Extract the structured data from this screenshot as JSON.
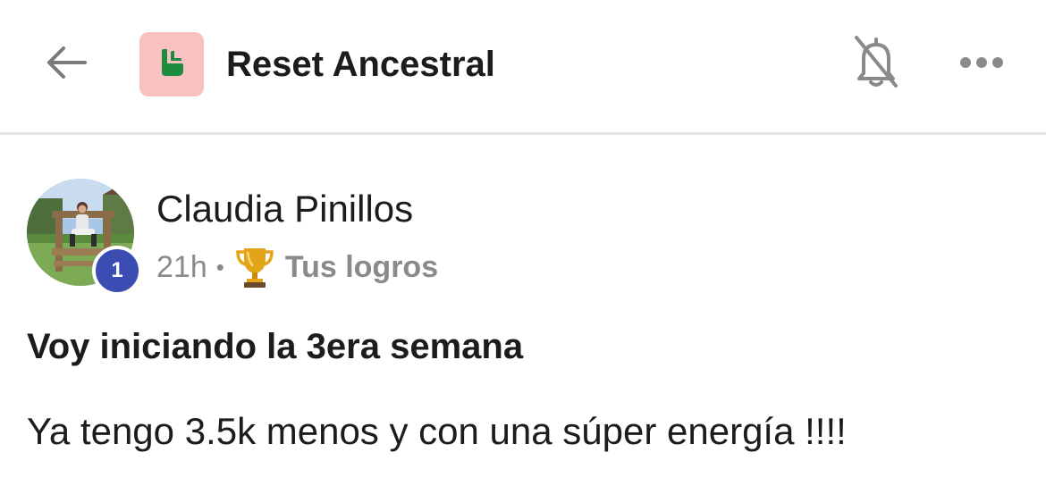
{
  "header": {
    "back_icon": "arrow-left-icon",
    "group_logo_icon": "group-logo-icon",
    "group_name": "Reset Ancestral",
    "notifications_icon": "bell-off-icon",
    "more_icon": "more-horizontal-icon"
  },
  "post": {
    "author": {
      "name": "Claudia Pinillos",
      "rank": "1",
      "avatar_icon": "avatar-photo"
    },
    "time": "21h",
    "separator": "•",
    "category_icon": "trophy-icon",
    "category": "Tus logros",
    "title": "Voy iniciando la 3era semana",
    "body": "Ya tengo 3.5k menos y con una súper energía !!!!"
  },
  "colors": {
    "logo_bg": "#f8c2c2",
    "logo_fg": "#1e8c3e",
    "rank_badge": "#3b4cb3",
    "muted_text": "#8a8a8a",
    "divider": "#e4e4e4"
  }
}
